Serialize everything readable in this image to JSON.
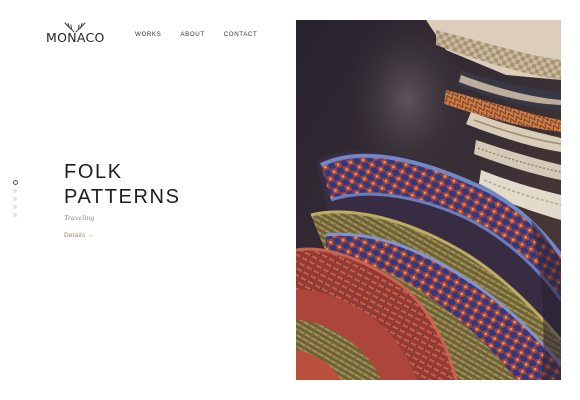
{
  "brand": {
    "name": "MONACO"
  },
  "nav": {
    "items": [
      {
        "label": "WORKS"
      },
      {
        "label": "ABOUT"
      },
      {
        "label": "CONTACT"
      }
    ]
  },
  "pager": {
    "count": 5,
    "active_index": 0
  },
  "hero": {
    "title_line1": "FOLK",
    "title_line2": "PATTERNS",
    "subtitle": "Traveling",
    "link_label": "Details",
    "link_arrow": "→"
  },
  "colors": {
    "accent": "#b07a68",
    "text": "#1d1d1d",
    "muted": "#8a8a8a"
  }
}
